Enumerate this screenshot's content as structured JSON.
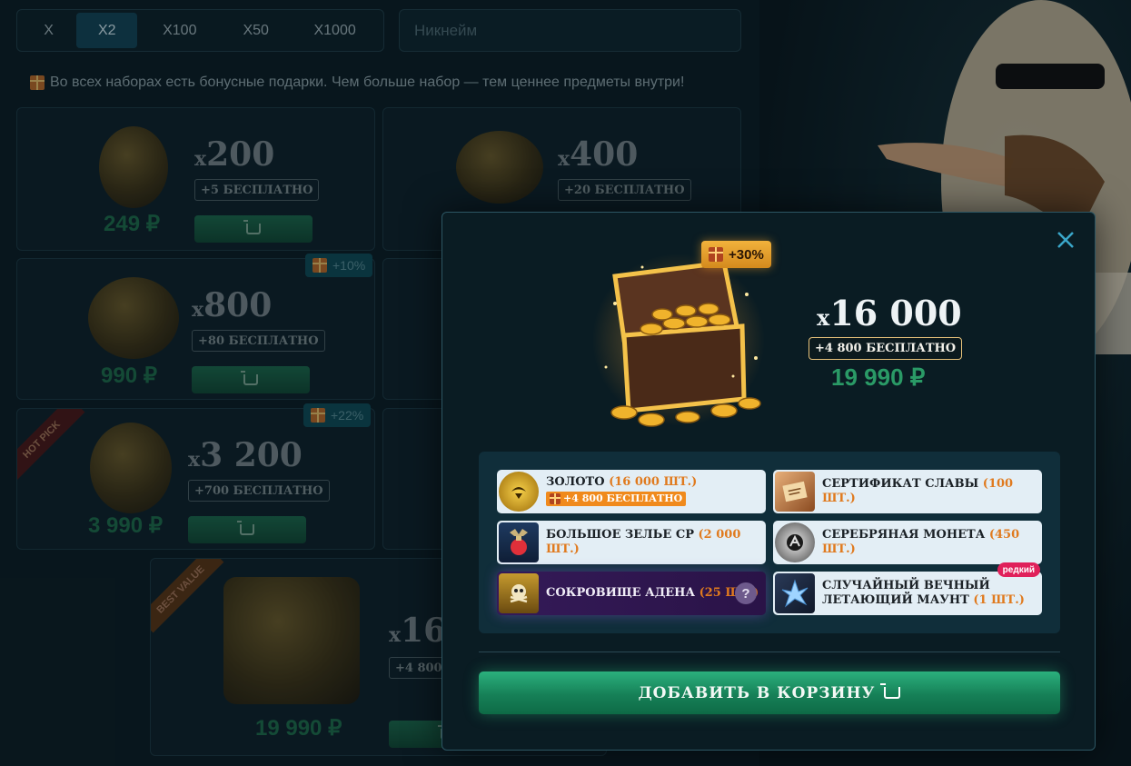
{
  "multiplier": {
    "options": [
      "X",
      "X2",
      "X100",
      "X50",
      "X1000"
    ],
    "selected": "X2"
  },
  "nickname": {
    "placeholder": "Никнейм"
  },
  "notice": "Во всех наборах есть бонусные подарки. Чем больше набор — тем ценнее предметы внутри!",
  "packs": [
    {
      "qty_prefix": "x",
      "qty": "200",
      "free": "+5 БЕСПЛАТНО",
      "price": "249 ₽"
    },
    {
      "qty_prefix": "x",
      "qty": "400",
      "free": "+20 БЕСПЛАТНО"
    },
    {
      "qty_prefix": "x",
      "qty": "800",
      "free": "+80 БЕСПЛАТНО",
      "price": "990 ₽",
      "bonus": "+10%"
    },
    {
      "qty_prefix": "x",
      "qty": "3 200",
      "free": "+700 БЕСПЛАТНО",
      "price": "3 990 ₽",
      "bonus": "+22%",
      "ribbon": "HOT PICK"
    },
    {
      "qty_prefix": "x",
      "qty": "16",
      "free": "+4 800",
      "price": "19 990 ₽",
      "ribbon": "BEST VALUE"
    }
  ],
  "modal": {
    "bonus_pct": "+30%",
    "qty_prefix": "x",
    "qty": "16 000",
    "free": "+4 800 БЕСПЛАТНО",
    "price": "19 990 ₽",
    "rewards": [
      {
        "name": "ЗОЛОТО",
        "amount": "(16 000 ШТ.)",
        "bonus": "+4 800 БЕСПЛАТНО",
        "icon": "gold-coin-icon"
      },
      {
        "name": "СЕРТИФИКАТ СЛАВЫ",
        "amount": "(100 ШТ.)",
        "icon": "certificate-icon"
      },
      {
        "name": "БОЛЬШОЕ ЗЕЛЬЕ СР",
        "amount": "(2 000 ШТ.)",
        "icon": "potion-icon"
      },
      {
        "name": "СЕРЕБРЯНАЯ МОНЕТА",
        "amount": "(450 ШТ.)",
        "icon": "silver-coin-icon"
      },
      {
        "name": "СОКРОВИЩЕ АДЕНА",
        "amount": "(25 ШТ.)",
        "icon": "treasure-icon",
        "help": "?"
      },
      {
        "name": "СЛУЧАЙНЫЙ ВЕЧНЫЙ ЛЕТАЮЩИЙ МАУНТ",
        "amount": "(1 ШТ.)",
        "icon": "mount-crystal-icon",
        "badge": "редкий"
      }
    ],
    "add_to_cart": "ДОБАВИТЬ В КОРЗИНУ"
  },
  "colors": {
    "accent_green": "#2a9a66",
    "button_green": "#168057",
    "bonus_orange": "#f08a1c",
    "rare_pink": "#e0205a",
    "legendary_purple": "#341a58"
  }
}
